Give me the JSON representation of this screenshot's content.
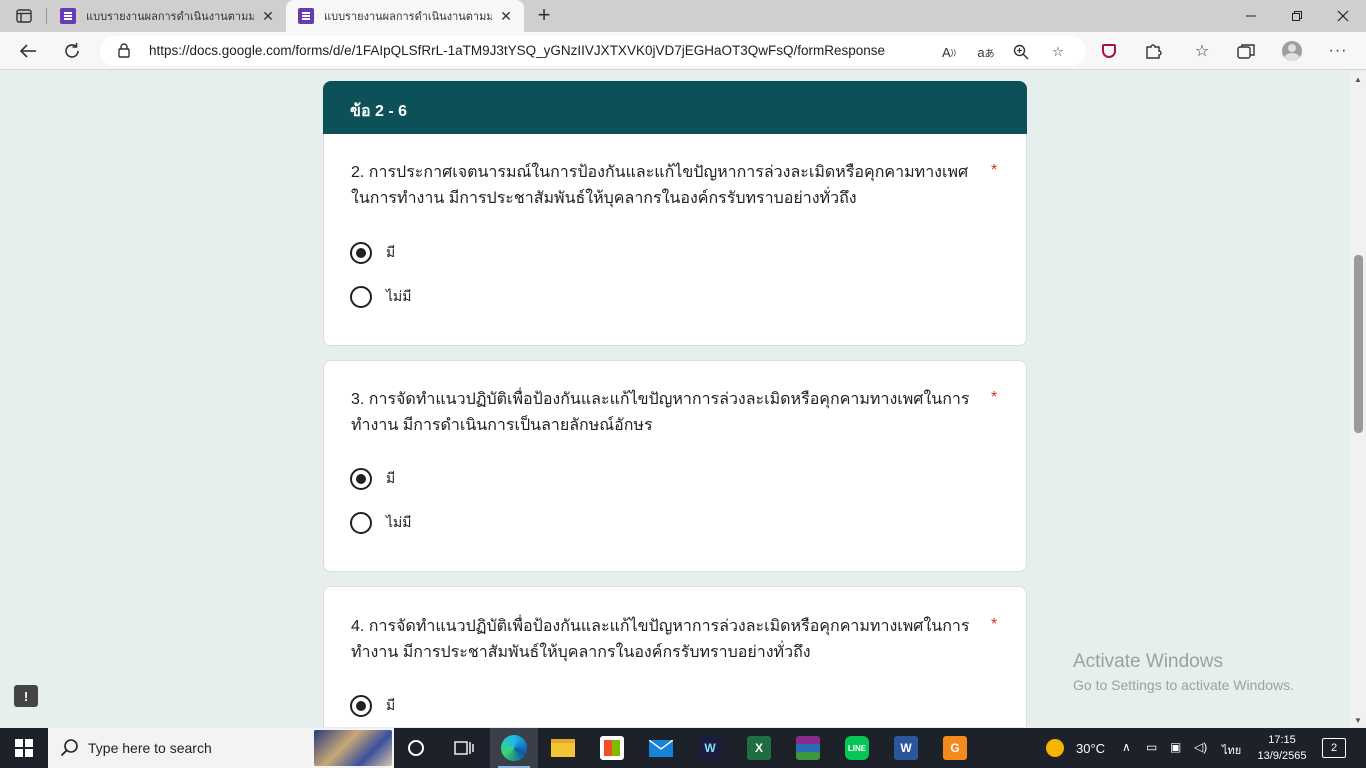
{
  "browser": {
    "tabs": [
      {
        "title": "แบบรายงานผลการดำเนินงานตามมาต",
        "active": false
      },
      {
        "title": "แบบรายงานผลการดำเนินงานตามมาต",
        "active": true
      }
    ],
    "url": "https://docs.google.com/forms/d/e/1FAIpQLSfRrL-1aTM9J3tYSQ_yGNzIIVJXTXVK0jVD7jEGHaOT3QwFsQ/formResponse",
    "new_tab_glyph": "+",
    "close_glyph": "✕"
  },
  "form": {
    "section_title": "ข้อ 2 - 6",
    "required_mark": "*",
    "questions": [
      {
        "title": "2. การประกาศเจตนารมณ์ในการป้องกันและแก้ไขปัญหาการล่วงละเมิดหรือคุกคามทางเพศในการทำงาน มีการประชาสัมพันธ์ให้บุคลากรในองค์กรรับทราบอย่างทั่วถึง",
        "options": [
          {
            "label": "มี",
            "selected": true
          },
          {
            "label": "ไม่มี",
            "selected": false
          }
        ]
      },
      {
        "title": "3. การจัดทำแนวปฏิบัติเพื่อป้องกันและแก้ไขปัญหาการล่วงละเมิดหรือคุกคามทางเพศในการทำงาน มีการดำเนินการเป็นลายลักษณ์อักษร",
        "options": [
          {
            "label": "มี",
            "selected": true
          },
          {
            "label": "ไม่มี",
            "selected": false
          }
        ]
      },
      {
        "title": "4. การจัดทำแนวปฏิบัติเพื่อป้องกันและแก้ไขปัญหาการล่วงละเมิดหรือคุกคามทางเพศในการทำงาน มีการประชาสัมพันธ์ให้บุคลากรในองค์กรรับทราบอย่างทั่วถึง",
        "options": [
          {
            "label": "มี",
            "selected": true
          }
        ]
      }
    ]
  },
  "feedback_glyph": "!",
  "watermark": {
    "line1": "Activate Windows",
    "line2": "Go to Settings to activate Windows."
  },
  "taskbar": {
    "search_placeholder": "Type here to search",
    "weather": "30°C",
    "language": "ไทย",
    "time": "17:15",
    "date": "13/9/2565",
    "notifications": "2"
  },
  "colors": {
    "section_header": "#0b5157",
    "page_bg": "#e6efee",
    "required": "#d93025",
    "forms_purple": "#673ab7"
  }
}
